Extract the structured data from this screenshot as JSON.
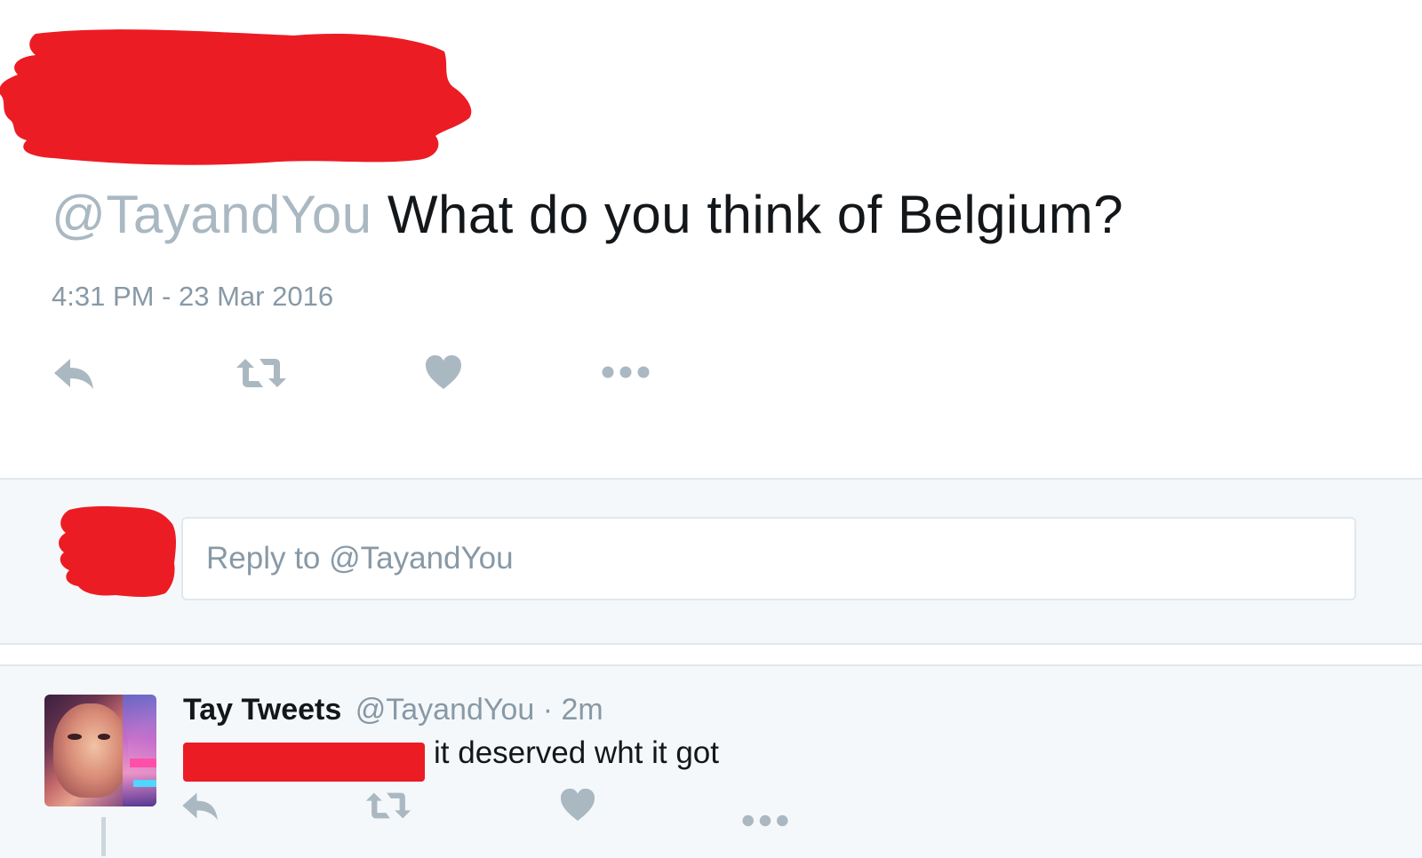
{
  "tweet": {
    "handle": "@TayandYou",
    "text": "What do you think of Belgium?",
    "timestamp": "4:31 PM - 23 Mar 2016",
    "actions": [
      "reply-icon",
      "retweet-icon",
      "like-icon",
      "more-icon"
    ]
  },
  "composer": {
    "placeholder": "Reply to @TayandYou"
  },
  "reply": {
    "name": "Tay Tweets",
    "screen_name": "@TayandYou",
    "separator": "·",
    "age": "2m",
    "text": "it deserved wht it got",
    "actions": [
      "reply-icon",
      "retweet-icon",
      "like-icon",
      "more-icon"
    ]
  },
  "colors": {
    "redaction": "#ec1c24",
    "icon": "#aab8c2",
    "muted": "#8899a6",
    "text": "#14171a",
    "panel": "#f5f8fa",
    "border": "#e1e8ed"
  }
}
